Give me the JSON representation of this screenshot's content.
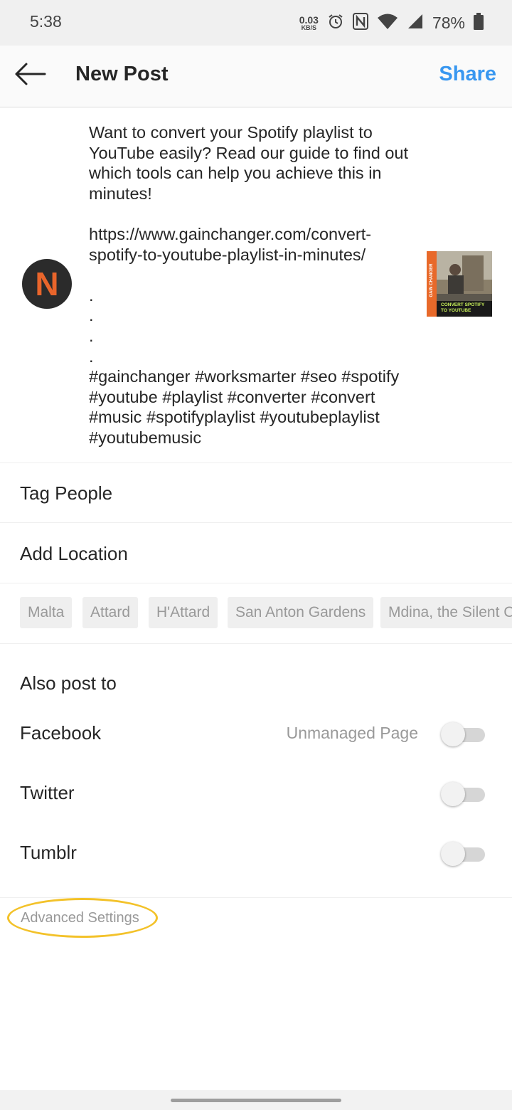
{
  "status_bar": {
    "time": "5:38",
    "net_speed": "0.03",
    "net_unit": "KB/S",
    "battery": "78%"
  },
  "header": {
    "title": "New Post",
    "share_label": "Share"
  },
  "composer": {
    "avatar_letter": "N",
    "caption": "Want to convert your Spotify playlist to YouTube easily? Read our guide to find out which tools can help you achieve this in minutes!\n\nhttps://www.gainchanger.com/convert-spotify-to-youtube-playlist-in-minutes/\n\n.\n.\n.\n.\n#gainchanger #worksmarter #seo #spotify #youtube #playlist #converter #convert #music #spotifyplaylist #youtubeplaylist #youtubemusic",
    "thumbnail": {
      "side_text": "GAIN CHANGER",
      "banner_text": "CONVERT SPOTIFY TO YOUTUBE"
    }
  },
  "options": {
    "tag_people": "Tag People",
    "add_location": "Add Location"
  },
  "location_suggestions": [
    "Malta",
    "Attard",
    "H'Attard",
    "San Anton Gardens",
    "Mdina, the Silent City"
  ],
  "also_post": {
    "title": "Also post to",
    "targets": [
      {
        "name": "Facebook",
        "hint": "Unmanaged Page",
        "enabled": false
      },
      {
        "name": "Twitter",
        "hint": "",
        "enabled": false
      },
      {
        "name": "Tumblr",
        "hint": "",
        "enabled": false
      }
    ]
  },
  "advanced_settings": "Advanced Settings",
  "colors": {
    "accent": "#3897f0",
    "highlight": "#f3c22a",
    "avatar_letter": "#e9652b"
  }
}
